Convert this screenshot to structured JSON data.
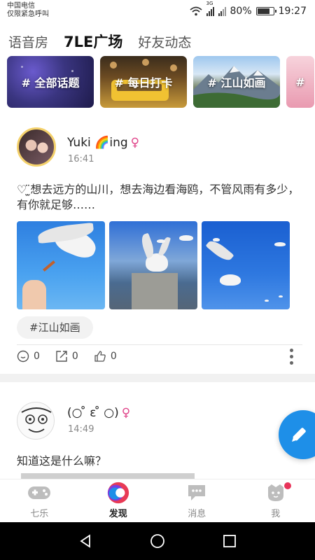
{
  "status_bar": {
    "carrier_line1": "中国电信",
    "carrier_line2": "仅限紧急呼叫",
    "network": "3G",
    "battery_percent": "80%",
    "battery_level": 0.8,
    "time": "19:27"
  },
  "top_tabs": [
    {
      "label": "语音房"
    },
    {
      "label": "7LE广场",
      "active": true
    },
    {
      "label": "好友动态"
    }
  ],
  "topics": [
    {
      "label": "# 全部话题"
    },
    {
      "label": "# 每日打卡"
    },
    {
      "label": "# 江山如画"
    },
    {
      "label": "#"
    }
  ],
  "posts": [
    {
      "username": "Yuki 🌈ing",
      "gender_symbol": "♀",
      "time": "16:41",
      "text": "♡ ̫̈想去远方的山川，想去海边看海鸥，不管风雨有多少，有你就足够……",
      "tag": "#江山如画",
      "comments": "0",
      "shares": "0",
      "likes": "0"
    },
    {
      "username": "(○ ̊ ε ̊ ○)",
      "gender_symbol": "♀",
      "time": "14:49",
      "text": "知道这是什么嘛？"
    }
  ],
  "bottom_nav": [
    {
      "label": "七乐",
      "icon": "gamepad-icon"
    },
    {
      "label": "发现",
      "icon": "discover-icon",
      "active": true
    },
    {
      "label": "消息",
      "icon": "message-icon"
    },
    {
      "label": "我",
      "icon": "profile-icon",
      "badge": true
    }
  ],
  "colors": {
    "accent_blue": "#1e8fe8",
    "female": "#e0458a",
    "badge": "#e8345a"
  }
}
